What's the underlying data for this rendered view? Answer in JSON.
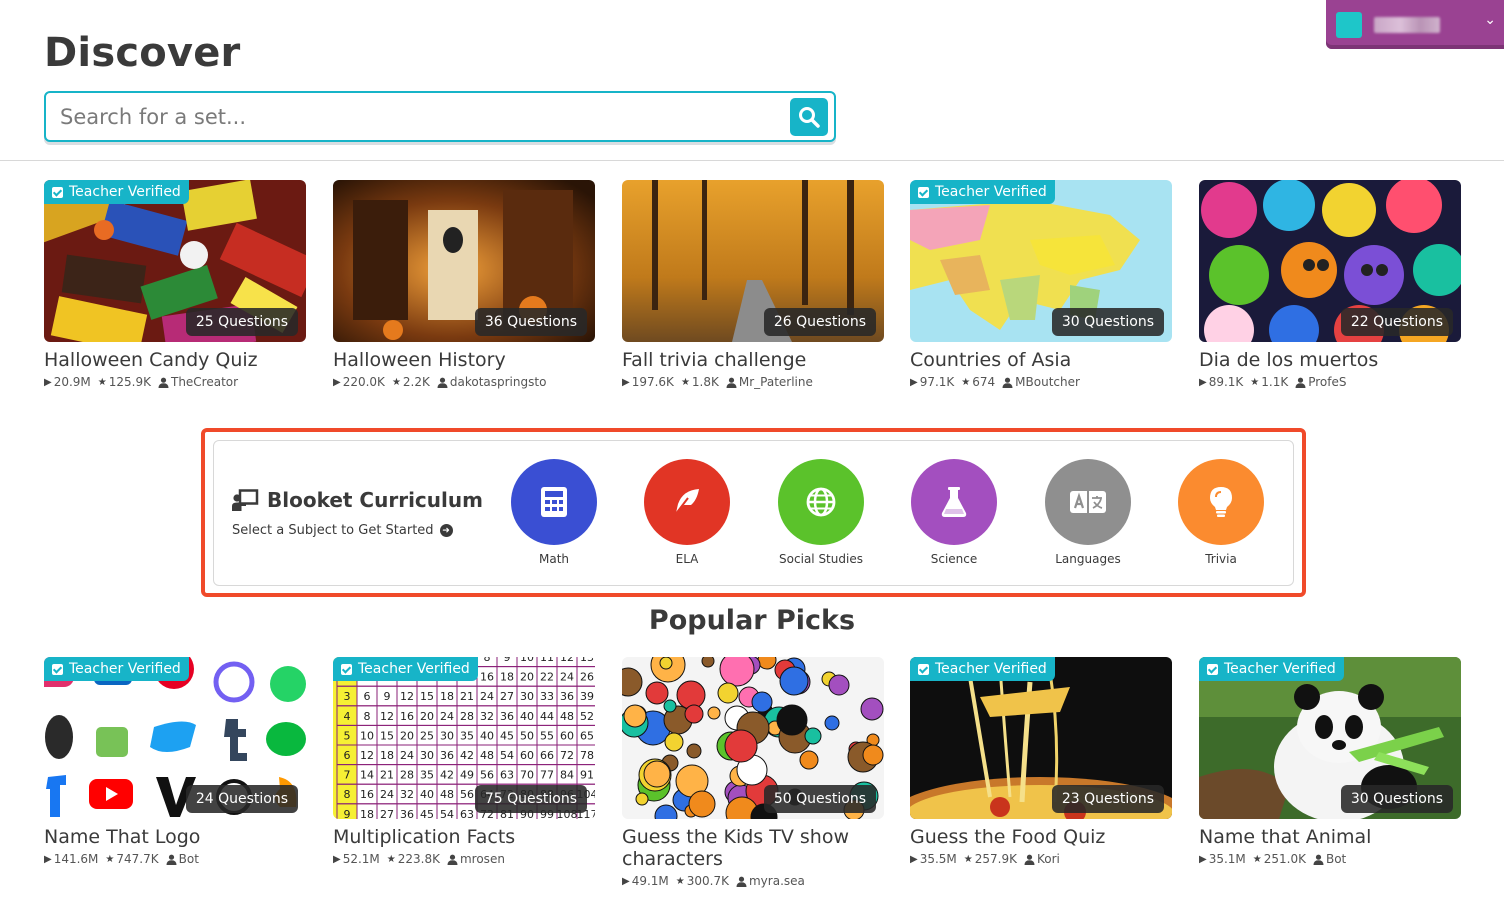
{
  "user_menu": {
    "chevron": "⌄"
  },
  "page": {
    "title": "Discover"
  },
  "search": {
    "placeholder": "Search for a set..."
  },
  "sets_top": [
    {
      "title": "Halloween Candy Quiz",
      "questions": "25 Questions",
      "plays": "20.9M",
      "favorites": "125.9K",
      "author": "TheCreator",
      "verified": true,
      "verified_label": "Teacher Verified"
    },
    {
      "title": "Halloween History",
      "questions": "36 Questions",
      "plays": "220.0K",
      "favorites": "2.2K",
      "author": "dakotaspringsto",
      "verified": false
    },
    {
      "title": "Fall trivia challenge",
      "questions": "26 Questions",
      "plays": "197.6K",
      "favorites": "1.8K",
      "author": "Mr_Paterline",
      "verified": false
    },
    {
      "title": "Countries of Asia",
      "questions": "30 Questions",
      "plays": "97.1K",
      "favorites": "674",
      "author": "MBoutcher",
      "verified": true,
      "verified_label": "Teacher Verified"
    },
    {
      "title": "Dia de los muertos",
      "questions": "22 Questions",
      "plays": "89.1K",
      "favorites": "1.1K",
      "author": "ProfeS",
      "verified": false
    }
  ],
  "curriculum": {
    "title": "Blooket Curriculum",
    "subtitle": "Select a Subject to Get Started",
    "subjects": [
      {
        "label": "Math",
        "color": "#3a4fd3",
        "icon": "calculator-icon"
      },
      {
        "label": "ELA",
        "color": "#e13525",
        "icon": "feather-icon"
      },
      {
        "label": "Social Studies",
        "color": "#5bc22b",
        "icon": "globe-icon"
      },
      {
        "label": "Science",
        "color": "#a34fbf",
        "icon": "flask-icon"
      },
      {
        "label": "Languages",
        "color": "#8f8f8f",
        "icon": "translate-icon"
      },
      {
        "label": "Trivia",
        "color": "#fb8b2f",
        "icon": "lightbulb-icon"
      }
    ]
  },
  "popular": {
    "title": "Popular Picks",
    "sets": [
      {
        "title": "Name That Logo",
        "questions": "24 Questions",
        "plays": "141.6M",
        "favorites": "747.7K",
        "author": "Bot",
        "verified": true,
        "verified_label": "Teacher Verified"
      },
      {
        "title": "Multiplication Facts",
        "questions": "75 Questions",
        "plays": "52.1M",
        "favorites": "223.8K",
        "author": "mrosen",
        "verified": true,
        "verified_label": "Teacher Verified"
      },
      {
        "title": "Guess the Kids TV show characters",
        "questions": "50 Questions",
        "plays": "49.1M",
        "favorites": "300.7K",
        "author": "myra.sea",
        "verified": false
      },
      {
        "title": "Guess the Food Quiz",
        "questions": "23 Questions",
        "plays": "35.5M",
        "favorites": "257.9K",
        "author": "Kori",
        "verified": true,
        "verified_label": "Teacher Verified"
      },
      {
        "title": "Name that Animal",
        "questions": "30 Questions",
        "plays": "35.1M",
        "favorites": "251.0K",
        "author": "Bot",
        "verified": true,
        "verified_label": "Teacher Verified"
      }
    ]
  },
  "colors": {
    "accent": "#17b4c8",
    "highlight": "#f04a2a",
    "user_menu": "#9a4292"
  }
}
